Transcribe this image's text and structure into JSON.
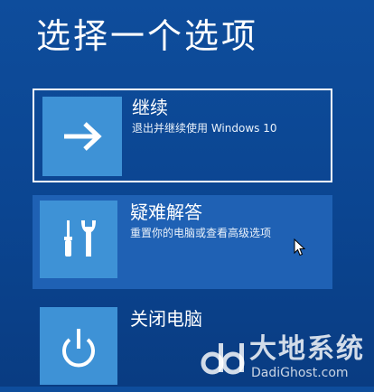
{
  "page": {
    "title": "选择一个选项"
  },
  "options": [
    {
      "title": "继续",
      "description": "退出并继续使用 Windows 10",
      "icon": "arrow-right-icon"
    },
    {
      "title": "疑难解答",
      "description": "重置你的电脑或查看高级选项",
      "icon": "tools-icon"
    },
    {
      "title": "关闭电脑",
      "description": "",
      "icon": "power-icon"
    }
  ],
  "watermark": {
    "name": "大地系统",
    "url": "DadiGhost.com"
  },
  "colors": {
    "background": "#0b4591",
    "tile": "#3e92d6",
    "hover_highlight": "#1f61b4",
    "text": "#ffffff"
  }
}
